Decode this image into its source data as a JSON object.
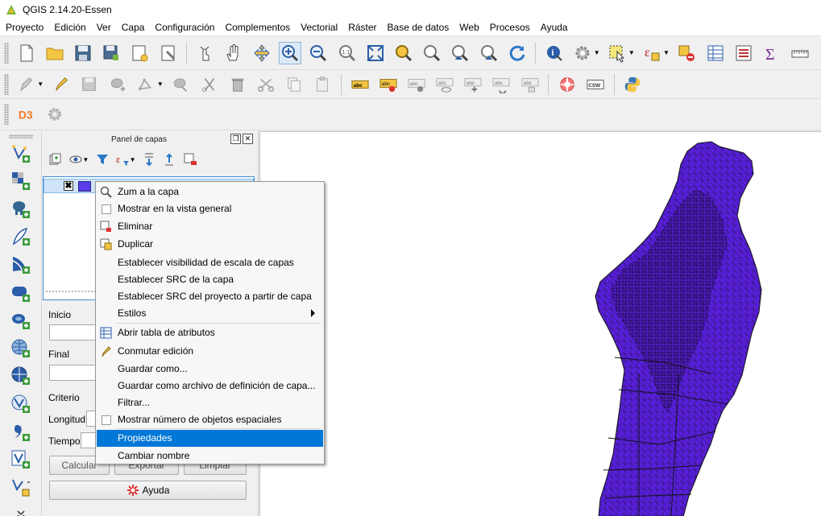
{
  "window": {
    "title": "QGIS 2.14.20-Essen"
  },
  "menubar": [
    "Proyecto",
    "Edición",
    "Ver",
    "Capa",
    "Configuración",
    "Complementos",
    "Vectorial",
    "Ráster",
    "Base de datos",
    "Web",
    "Procesos",
    "Ayuda"
  ],
  "toolbar3": {
    "plugin_label": "D3"
  },
  "layers_panel": {
    "title": "Panel de capas",
    "layer": {
      "checked": "✖",
      "color": "#5a3ce8"
    }
  },
  "side_form": {
    "inicio_label": "Inicio",
    "final_label": "Final",
    "criterio_label": "Criterio",
    "longitud_label": "Longitud",
    "tiempo_label": "Tiempo",
    "calcular_button": "Calcular",
    "exportar_button": "Exportar",
    "limpiar_button": "Limpiar",
    "ayuda_button": "Ayuda"
  },
  "context_menu": {
    "items": [
      {
        "label": "Zum a la capa"
      },
      {
        "label": "Mostrar en la vista general"
      },
      {
        "label": "Eliminar"
      },
      {
        "label": "Duplicar"
      },
      {
        "label": "Establecer visibilidad de escala de capas"
      },
      {
        "label": "Establecer SRC de la capa"
      },
      {
        "label": "Establecer SRC del proyecto a partir de capa"
      },
      {
        "label": "Estilos"
      },
      {
        "label": "Abrir tabla de atributos"
      },
      {
        "label": "Conmutar edición"
      },
      {
        "label": "Guardar como..."
      },
      {
        "label": "Guardar como archivo de definición de capa..."
      },
      {
        "label": "Filtrar..."
      },
      {
        "label": "Mostrar número de objetos espaciales"
      },
      {
        "label": "Propiedades"
      },
      {
        "label": "Cambiar nombre"
      }
    ],
    "selected": "Propiedades"
  },
  "colors": {
    "accent": "#0078d7",
    "map_fill": "#5a1fe0",
    "map_stroke": "#111111"
  }
}
